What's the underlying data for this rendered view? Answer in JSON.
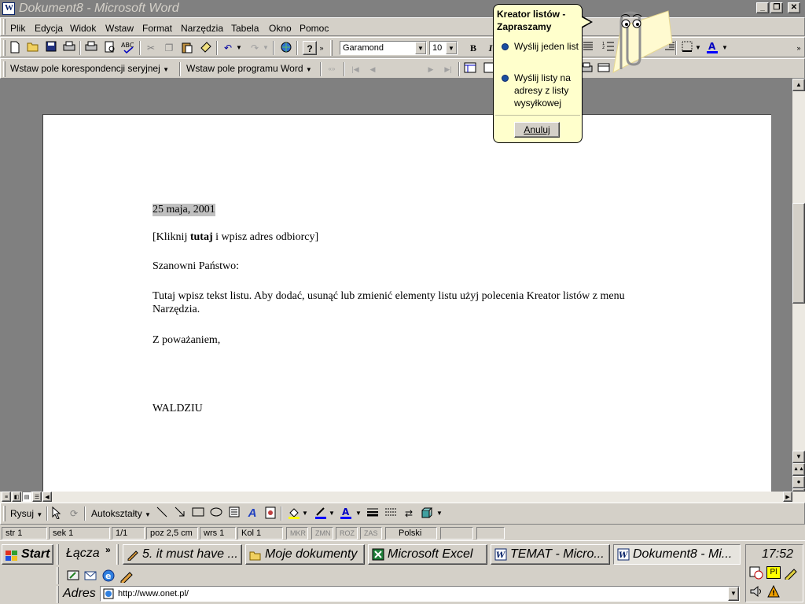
{
  "window": {
    "title": "Dokument8 - Microsoft Word"
  },
  "menubar": {
    "items": [
      "Plik",
      "Edycja",
      "Widok",
      "Wstaw",
      "Format",
      "Narzędzia",
      "Tabela",
      "Okno",
      "Pomoc"
    ]
  },
  "formatting": {
    "font": "Garamond",
    "size": "10",
    "bold": "B",
    "italic": "I"
  },
  "mailmerge": {
    "insert_merge_field": "Wstaw pole korespondencji seryjnej",
    "insert_word_field": "Wstaw pole programu Word"
  },
  "assistant": {
    "title": "Kreator listów - Zapraszamy",
    "option1": "Wyślij jeden list",
    "option2": "Wyślij listy na adresy z listy wysyłkowej",
    "cancel": "Anuluj"
  },
  "document": {
    "date": "25 maja, 2001",
    "address_pre": "[Kliknij ",
    "address_bold": "tutaj",
    "address_post": " i wpisz adres odbiorcy]",
    "salutation": "Szanowni Państwo:",
    "body_line1": "Tutaj wpisz tekst listu.  Aby dodać, usunąć lub zmienić elementy listu użyj polecenia Kreator listów z menu",
    "body_line2": "Narzędzia.",
    "closing": "Z poważaniem,",
    "signature": "WALDZIU"
  },
  "drawing": {
    "draw": "Rysuj",
    "autoshapes": "Autokształty"
  },
  "statusbar": {
    "page": "str 1",
    "section": "sek 1",
    "pages": "1/1",
    "position": "poz 2,5 cm",
    "line": "wrs 1",
    "column": "Kol 1",
    "rec": "MKR",
    "trk": "ZMN",
    "ext": "ROZ",
    "ovr": "ZAS",
    "language": "Polski"
  },
  "taskbar": {
    "start": "Start",
    "links": "Łącza",
    "tasks": [
      "5. it must have ...",
      "Moje dokumenty",
      "Microsoft Excel",
      "TEMAT - Micro...",
      "Dokument8 - Mi..."
    ],
    "address_label": "Adres",
    "address_value": "http://www.onet.pl/",
    "clock": "17:52",
    "lang_indicator": "Pl"
  }
}
